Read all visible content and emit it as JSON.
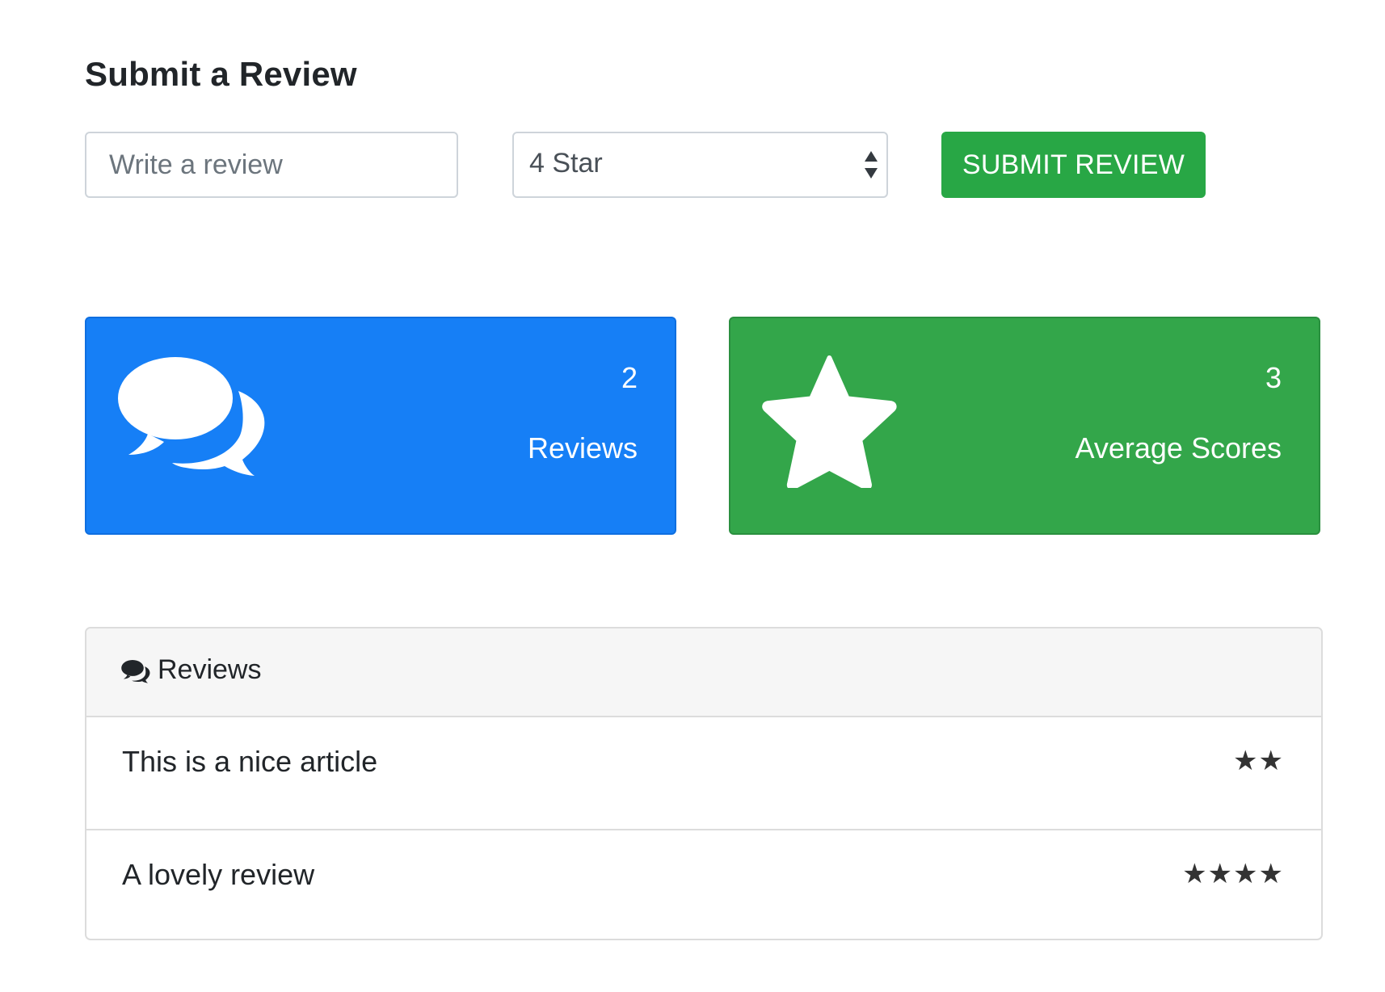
{
  "page": {
    "title": "Submit a Review"
  },
  "form": {
    "review_placeholder": "Write a review",
    "review_value": "",
    "rating_selected": "4 Star",
    "submit_label": "SUBMIT REVIEW"
  },
  "stats": [
    {
      "count": "2",
      "label": "Reviews",
      "icon": "comments-icon",
      "color": "#167ff6"
    },
    {
      "count": "3",
      "label": "Average Scores",
      "icon": "star-icon",
      "color": "#33a64a"
    }
  ],
  "reviews_panel": {
    "title": "Reviews",
    "icon": "comments-icon",
    "items": [
      {
        "text": "This is a nice article",
        "stars": "★★",
        "rating": 2
      },
      {
        "text": "A lovely review",
        "stars": "★★★★",
        "rating": 4
      }
    ]
  },
  "colors": {
    "primary": "#167ff6",
    "success": "#28a745",
    "text": "#212529",
    "border": "#ced4da"
  }
}
